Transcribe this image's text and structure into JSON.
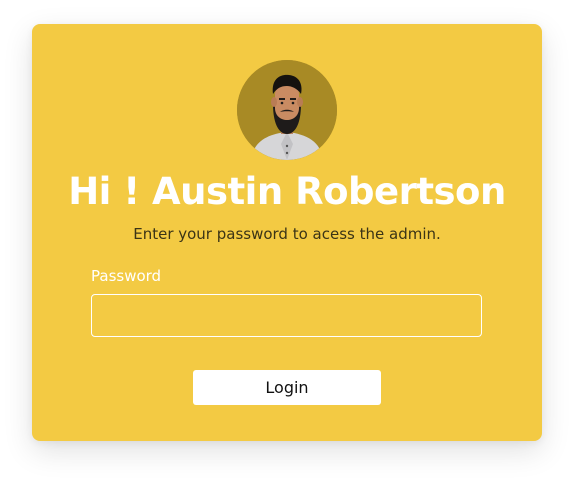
{
  "login": {
    "avatar_icon": "user-avatar",
    "greeting": "Hi ! Austin Robertson",
    "subtitle": "Enter your password to acess the admin.",
    "password_label": "Password",
    "password_value": "",
    "password_placeholder": "",
    "login_button": "Login"
  },
  "colors": {
    "card_background": "#f3ca43",
    "avatar_background": "#a88a25",
    "greeting_text": "#ffffff",
    "subtitle_text": "#3b3416",
    "button_background": "#ffffff"
  }
}
